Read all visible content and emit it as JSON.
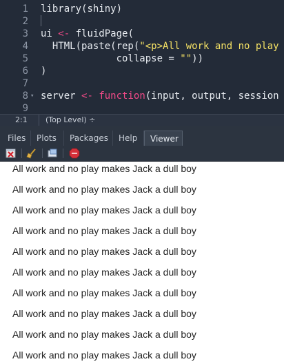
{
  "editor": {
    "lines": [
      {
        "n": "1",
        "parts": [
          [
            "fn",
            "library"
          ],
          [
            "plain",
            "("
          ],
          [
            "plain",
            "shiny"
          ],
          [
            "plain",
            ")"
          ]
        ]
      },
      {
        "n": "2",
        "parts": []
      },
      {
        "n": "3",
        "parts": [
          [
            "plain",
            "ui "
          ],
          [
            "op",
            "<-"
          ],
          [
            "plain",
            " fluidPage("
          ]
        ]
      },
      {
        "n": "4",
        "parts": [
          [
            "plain",
            "  HTML(paste(rep("
          ],
          [
            "str",
            "\"<p>All work and no play"
          ]
        ]
      },
      {
        "n": "5",
        "parts": [
          [
            "plain",
            "             collapse = "
          ],
          [
            "str",
            "\"\""
          ],
          [
            "plain",
            "))"
          ]
        ]
      },
      {
        "n": "6",
        "parts": [
          [
            "plain",
            ")"
          ]
        ]
      },
      {
        "n": "7",
        "parts": []
      },
      {
        "n": "8",
        "parts": [
          [
            "plain",
            "server "
          ],
          [
            "op",
            "<-"
          ],
          [
            "plain",
            " "
          ],
          [
            "kw",
            "function"
          ],
          [
            "plain",
            "(input, output, session"
          ]
        ]
      },
      {
        "n": "9",
        "parts": []
      }
    ],
    "status": {
      "position": "2:1",
      "scope": "(Top Level) ÷"
    }
  },
  "pane": {
    "tabs": [
      {
        "label": "Files",
        "active": false
      },
      {
        "label": "Plots",
        "active": false
      },
      {
        "label": "Packages",
        "active": false
      },
      {
        "label": "Help",
        "active": false
      },
      {
        "label": "Viewer",
        "active": true
      }
    ],
    "toolbar": [
      "clear-viewer-icon",
      "broom-icon",
      "export-icon",
      "stop-icon"
    ]
  },
  "viewer": {
    "paragraphs": [
      "All work and no play makes Jack a dull boy",
      "All work and no play makes Jack a dull boy",
      "All work and no play makes Jack a dull boy",
      "All work and no play makes Jack a dull boy",
      "All work and no play makes Jack a dull boy",
      "All work and no play makes Jack a dull boy",
      "All work and no play makes Jack a dull boy",
      "All work and no play makes Jack a dull boy",
      "All work and no play makes Jack a dull boy",
      "All work and no play makes Jack a dull boy"
    ]
  },
  "colors": {
    "editor_bg": "#232b38",
    "keyword": "#f24a88",
    "string": "#f5e265",
    "pane_bg": "#2c3440"
  }
}
